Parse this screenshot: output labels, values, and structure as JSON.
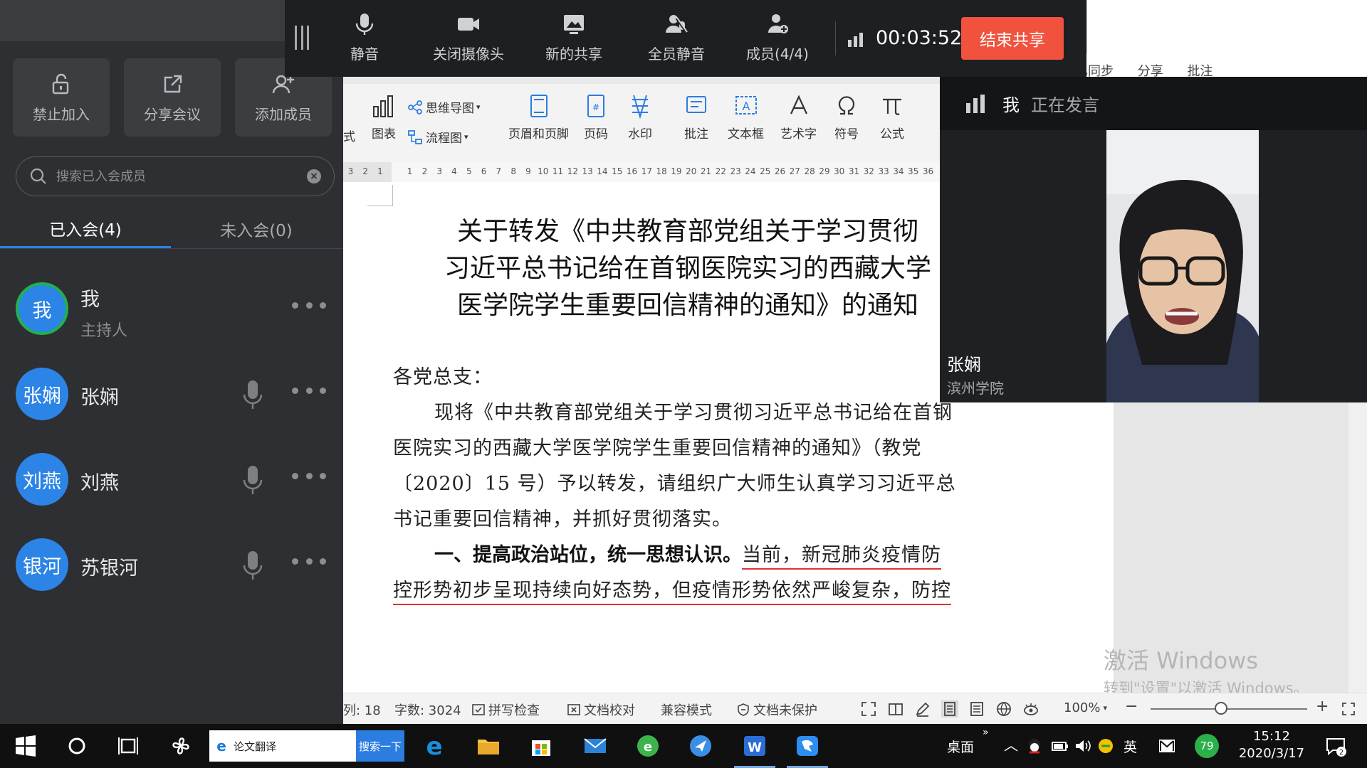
{
  "left_panel": {
    "actions": [
      {
        "label": "禁止加入",
        "icon": "lock-icon"
      },
      {
        "label": "分享会议",
        "icon": "share-icon"
      },
      {
        "label": "添加成员",
        "icon": "add-user-icon"
      }
    ],
    "search": {
      "placeholder": "搜索已入会成员"
    },
    "tabs": [
      {
        "label": "已入会(4)",
        "active": true
      },
      {
        "label": "未入会(0)",
        "active": false
      }
    ],
    "members": [
      {
        "avatar": "我",
        "name": "我",
        "role": "主持人",
        "host": true,
        "mic": false
      },
      {
        "avatar": "张娴",
        "name": "张娴",
        "role": "",
        "host": false,
        "mic": true
      },
      {
        "avatar": "刘燕",
        "name": "刘燕",
        "role": "",
        "host": false,
        "mic": true
      },
      {
        "avatar": "银河",
        "name": "苏银河",
        "role": "",
        "host": false,
        "mic": true
      }
    ]
  },
  "share_toolbar": {
    "buttons": [
      {
        "label": "静音",
        "icon": "microphone-icon"
      },
      {
        "label": "关闭摄像头",
        "icon": "camera-icon"
      },
      {
        "label": "新的共享",
        "icon": "new-share-icon"
      },
      {
        "label": "全员静音",
        "icon": "mute-all-icon"
      },
      {
        "label": "成员(4/4)",
        "icon": "members-icon"
      }
    ],
    "timer": "00:03:52",
    "end_share": "结束共享"
  },
  "wps": {
    "topright": [
      "已同步",
      "分享",
      "批注"
    ],
    "ribbon": {
      "partial_left": "式",
      "items": [
        {
          "label": "图表",
          "icon": "chart-icon"
        },
        {
          "label": "页眉和页脚",
          "icon": "header-footer-icon"
        },
        {
          "label": "页码",
          "icon": "page-number-icon"
        },
        {
          "label": "水印",
          "icon": "watermark-icon"
        },
        {
          "label": "批注",
          "icon": "comment-icon"
        },
        {
          "label": "文本框",
          "icon": "textbox-icon"
        },
        {
          "label": "艺术字",
          "icon": "wordart-icon"
        },
        {
          "label": "符号",
          "icon": "symbol-icon"
        },
        {
          "label": "公式",
          "icon": "formula-icon"
        }
      ],
      "mindmap": "思维导图",
      "flowchart": "流程图"
    },
    "ruler_ticks": [
      "3",
      "2",
      "1",
      "",
      "1",
      "2",
      "3",
      "4",
      "5",
      "6",
      "7",
      "8",
      "9",
      "10",
      "11",
      "12",
      "13",
      "14",
      "15",
      "16",
      "17",
      "18",
      "19",
      "20",
      "21",
      "22",
      "23",
      "24",
      "25",
      "26",
      "27",
      "28",
      "29",
      "30",
      "31",
      "32",
      "33",
      "34",
      "35",
      "36"
    ],
    "document": {
      "title_lines": [
        "关于转发《中共教育部党组关于学习贯彻",
        "习近平总书记给在首钢医院实习的西藏大学",
        "医学院学生重要回信精神的通知》的通知"
      ],
      "salutation": "各党总支：",
      "body_lines": [
        "现将《中共教育部党组关于学习贯彻习近平总书记给在首钢",
        "医院实习的西藏大学医学院学生重要回信精神的通知》（教党",
        "〔2020〕15 号）予以转发，请组织广大师生认真学习习近平总",
        "书记重要回信精神，并抓好贯彻落实。"
      ],
      "section_heading": "一、提高政治站位，统一思想认识。",
      "section_text_1": "当前，新冠肺炎疫情防",
      "section_text_2": "控形势初步呈现持续向好态势，但疫情形势依然严峻复杂，防控"
    },
    "statusbar": {
      "column": "列: 18",
      "word_count": "字数: 3024",
      "spell_check": "拼写检查",
      "proofread": "文档校对",
      "compat_mode": "兼容模式",
      "protect": "文档未保护",
      "zoom": "100%"
    },
    "activate": {
      "line1": "激活 Windows",
      "line2": "转到\"设置\"以激活 Windows。"
    }
  },
  "video": {
    "speaking_name": "我",
    "speaking_status": "正在发言",
    "participant_name": "张娴",
    "participant_org": "滨州学院"
  },
  "taskbar": {
    "search_value": "论文翻译",
    "search_button": "搜索一下",
    "desktop": "桌面",
    "ime": "英",
    "badge": "79",
    "time": "15:12",
    "date": "2020/3/17",
    "notifications": "2"
  },
  "colors": {
    "accent_blue": "#2b84e6",
    "end_share_red": "#f0523e",
    "host_ring_green": "#22b14c",
    "panel_bg": "#2d2f33",
    "toolbar_bg": "#1e1f22"
  }
}
